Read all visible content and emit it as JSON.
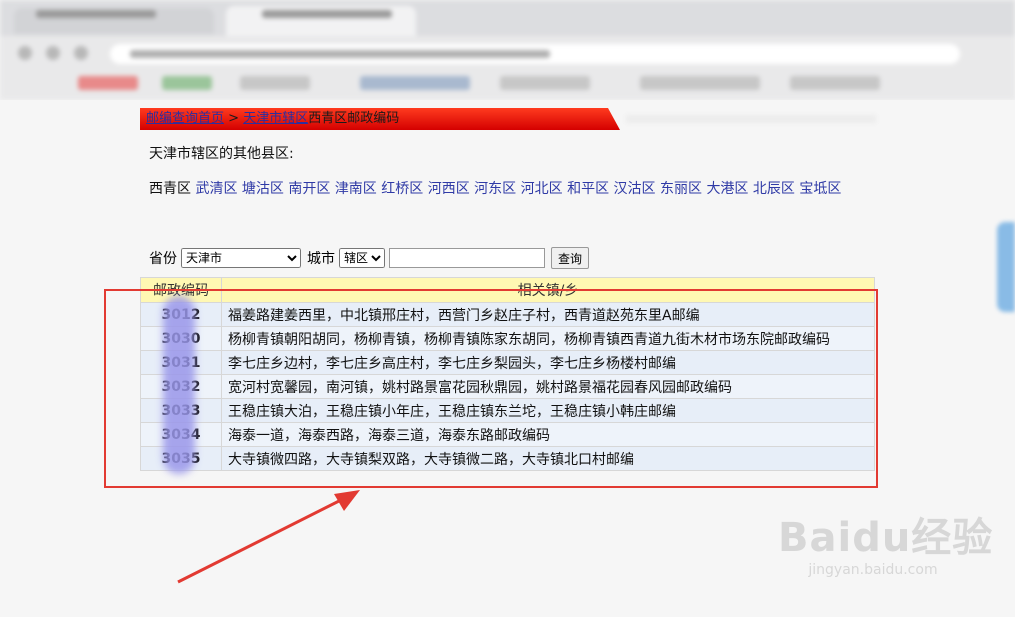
{
  "breadcrumb": {
    "home": "邮编查询首页",
    "sep": " > ",
    "city": "天津市辖区",
    "current": "西青区邮政编码"
  },
  "other_districts_title": "天津市辖区的其他县区:",
  "districts": {
    "current": "西青区",
    "links": [
      "武清区",
      "塘沽区",
      "南开区",
      "津南区",
      "红桥区",
      "河西区",
      "河东区",
      "河北区",
      "和平区",
      "汉沽区",
      "东丽区",
      "大港区",
      "北辰区",
      "宝坻区"
    ]
  },
  "search": {
    "province_label": "省份",
    "province_value": "天津市",
    "city_label": "城市",
    "city_value": "辖区",
    "query_value": "",
    "button": "查询"
  },
  "table": {
    "headers": [
      "邮政编码",
      "相关镇/乡"
    ],
    "rows": [
      {
        "code": "3012",
        "areas": "福姜路建姜西里，中北镇邢庄村，西营门乡赵庄子村，西青道赵苑东里A邮编"
      },
      {
        "code": "3030",
        "areas": "杨柳青镇朝阳胡同，杨柳青镇，杨柳青镇陈家东胡同，杨柳青镇西青道九街木材市场东院邮政编码"
      },
      {
        "code": "3031",
        "areas": "李七庄乡边村，李七庄乡高庄村，李七庄乡梨园头，李七庄乡杨楼村邮编"
      },
      {
        "code": "3032",
        "areas": "宽河村宽馨园，南河镇，姚村路景富花园秋鼎园，姚村路景福花园春风园邮政编码"
      },
      {
        "code": "3033",
        "areas": "王稳庄镇大泊，王稳庄镇小年庄，王稳庄镇东兰坨，王稳庄镇小韩庄邮编"
      },
      {
        "code": "3034",
        "areas": "海泰一道，海泰西路，海泰三道，海泰东路邮政编码"
      },
      {
        "code": "3035",
        "areas": "大寺镇微四路，大寺镇梨双路，大寺镇微二路，大寺镇北口村邮编"
      }
    ]
  },
  "watermark": {
    "main": "Baidu经验",
    "sub": "jingyan.baidu.com"
  },
  "colors": {
    "breadcrumb_red": "#e01010",
    "link_blue": "#2f3aa6",
    "header_yellow": "#fff8b3",
    "annotation_red": "#e23a32"
  }
}
